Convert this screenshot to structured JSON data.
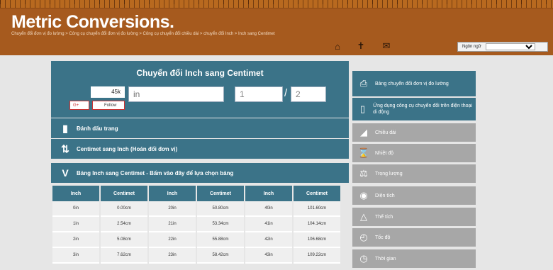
{
  "header": {
    "logo": "Metric Conversions.",
    "breadcrumb": "Chuyển đổi đơn vị đo lường > Công cụ chuyển đổi đơn vị đo lường > Công cụ chuyển đổi chiều dài > chuyển đổi Inch > Inch sang Centimet",
    "language_label": "Ngôn ngữ"
  },
  "converter": {
    "title": "Chuyển đổi Inch sang Centimet",
    "like_count": "45k",
    "gplus_label": "G+",
    "follow_label": "Follow",
    "input_placeholder": "in",
    "numerator": "1",
    "denominator": "2"
  },
  "bars": {
    "bookmark": "Đánh dấu trang",
    "swap": "Centimet sang Inch (Hoán đổi đơn vị)",
    "table_toggle": "Bảng Inch sang Centimet - Bấm vào đây để lựa chọn bảng"
  },
  "table": {
    "headers": [
      "Inch",
      "Centimet",
      "Inch",
      "Centimet",
      "Inch",
      "Centimet"
    ],
    "rows": [
      [
        "0in",
        "0.00cm",
        "20in",
        "50.80cm",
        "40in",
        "101.60cm"
      ],
      [
        "1in",
        "2.54cm",
        "21in",
        "53.34cm",
        "41in",
        "104.14cm"
      ],
      [
        "2in",
        "5.08cm",
        "22in",
        "55.88cm",
        "42in",
        "106.68cm"
      ],
      [
        "3in",
        "7.62cm",
        "23in",
        "58.42cm",
        "43in",
        "109.22cm"
      ]
    ]
  },
  "sidebar": {
    "items": [
      {
        "label": "Bảng chuyển đổi đơn vị đo lường",
        "icon": "printer-icon"
      },
      {
        "label": "Ứng dụng công cụ chuyển đổi trên điện thoại di động",
        "icon": "phone-icon"
      },
      {
        "label": "Chiều dài",
        "icon": "ruler-icon"
      },
      {
        "label": "Nhiệt độ",
        "icon": "thermometer-icon"
      },
      {
        "label": "Trọng lượng",
        "icon": "scale-icon"
      },
      {
        "label": "Diện tích",
        "icon": "area-icon"
      },
      {
        "label": "Thể tích",
        "icon": "flask-icon"
      },
      {
        "label": "Tốc độ",
        "icon": "speedometer-icon"
      },
      {
        "label": "Thời gian",
        "icon": "clock-icon"
      }
    ]
  },
  "colors": {
    "header_bg": "#a65a1e",
    "panel_bg": "#3b7388",
    "sidebar_grey": "#a7a7a7",
    "page_bg": "#e6e6e6"
  }
}
